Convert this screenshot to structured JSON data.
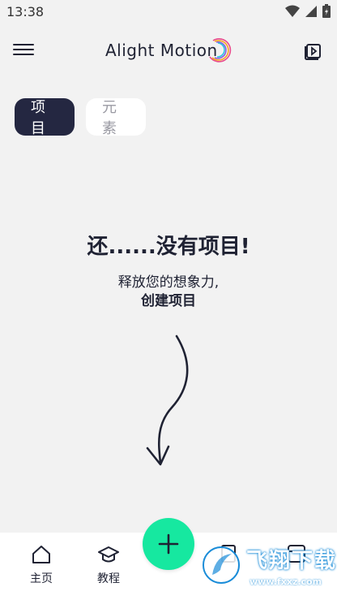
{
  "status_bar": {
    "time": "13:38"
  },
  "app_bar": {
    "brand": "Alight Motion"
  },
  "tabs": [
    {
      "label": "项目",
      "active": true
    },
    {
      "label": "元素",
      "active": false
    }
  ],
  "empty_state": {
    "title": "还......没有项目!",
    "subtitle_line1": "释放您的想象力,",
    "subtitle_line2": "创建项目"
  },
  "bottom_nav": {
    "items": [
      {
        "label": "主页",
        "icon": "home-icon"
      },
      {
        "label": "教程",
        "icon": "graduation-cap-icon"
      }
    ]
  },
  "fab": {
    "icon": "plus-icon",
    "color": "#16e8a0"
  },
  "watermark": {
    "text": "飞翔下载",
    "url": "www.fxxz.com"
  },
  "colors": {
    "dark": "#242741",
    "accent": "#16e8a0",
    "background": "#f2f2f2"
  }
}
